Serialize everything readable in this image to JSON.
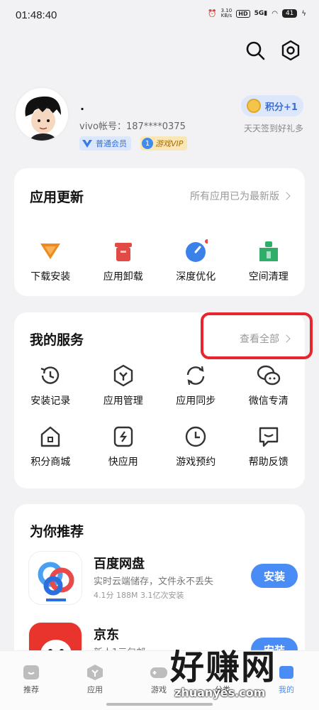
{
  "status": {
    "time": "01:48:40",
    "net_rate": "3.10",
    "net_unit": "KB/s",
    "hd": "HD",
    "signal": "5G",
    "battery": "41"
  },
  "profile": {
    "name": "·",
    "account": "vivo帐号：187****0375",
    "member_badge": "普通会员",
    "vip_badge": "游戏VIP",
    "vip_level": "1",
    "points_button": "积分+1",
    "points_sub": "天天签到好礼多"
  },
  "update_card": {
    "title": "应用更新",
    "link": "所有应用已为最新版",
    "items": [
      {
        "label": "下载安装",
        "icon": "download-icon",
        "color": "#f08a1d"
      },
      {
        "label": "应用卸载",
        "icon": "trash-icon",
        "color": "#e24a45"
      },
      {
        "label": "深度优化",
        "icon": "optimize-icon",
        "color": "#3a82ea"
      },
      {
        "label": "空间清理",
        "icon": "clean-icon",
        "color": "#2fae6a"
      }
    ]
  },
  "service_card": {
    "title": "我的服务",
    "link": "查看全部",
    "items": [
      {
        "label": "安装记录",
        "icon": "history-icon"
      },
      {
        "label": "应用管理",
        "icon": "app-manage-icon"
      },
      {
        "label": "应用同步",
        "icon": "sync-icon"
      },
      {
        "label": "微信专清",
        "icon": "wechat-icon"
      },
      {
        "label": "积分商城",
        "icon": "shop-icon"
      },
      {
        "label": "快应用",
        "icon": "quick-app-icon"
      },
      {
        "label": "游戏预约",
        "icon": "clock-icon"
      },
      {
        "label": "帮助反馈",
        "icon": "feedback-icon"
      }
    ]
  },
  "recommend": {
    "title": "为你推荐",
    "apps": [
      {
        "name": "百度网盘",
        "desc": "实时云端储存，文件永不丢失",
        "meta": "4.1分  188M  3.1亿次安装",
        "button": "安装"
      },
      {
        "name": "京东",
        "desc": "新人1元包邮",
        "meta": "",
        "button": "安装"
      }
    ]
  },
  "bottom_nav": [
    {
      "label": "推荐"
    },
    {
      "label": "应用"
    },
    {
      "label": "游戏"
    },
    {
      "label": "分类"
    },
    {
      "label": "我的"
    }
  ],
  "watermark": {
    "text": "好赚网",
    "sub": "zhuanyes.com"
  },
  "accent": "#4a8cf6"
}
